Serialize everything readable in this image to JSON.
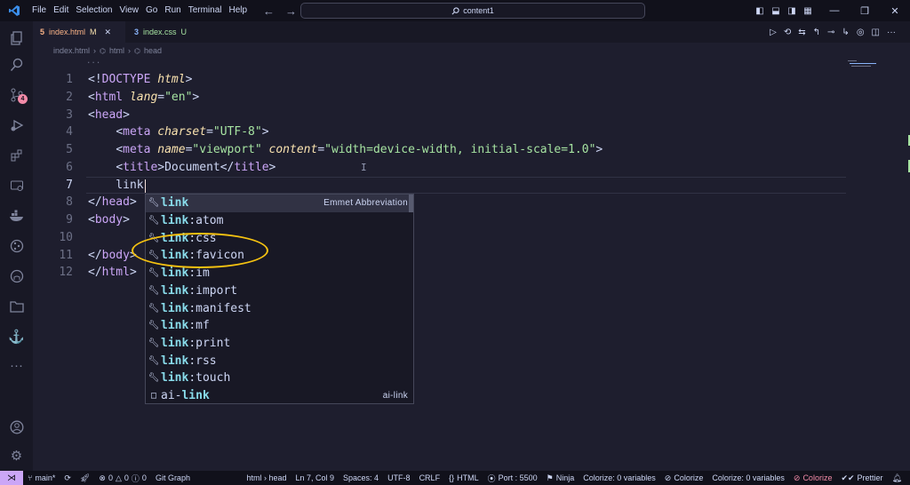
{
  "titlebar": {
    "menu": [
      "File",
      "Edit",
      "Selection",
      "View",
      "Go",
      "Run",
      "Terminal",
      "Help"
    ],
    "search_text": "content1"
  },
  "activity": {
    "source_control_badge": "4"
  },
  "tabs": [
    {
      "name": "index.html",
      "status": "M",
      "icon": "html-file-icon"
    },
    {
      "name": "index.css",
      "status": "U",
      "icon": "css-file-icon"
    }
  ],
  "breadcrumb": [
    "index.html",
    "html",
    "head"
  ],
  "editor": {
    "fold_dots": "...",
    "line_numbers": [
      "1",
      "2",
      "3",
      "4",
      "5",
      "6",
      "7",
      "8",
      "9",
      "10",
      "11",
      "12"
    ],
    "current_line": "7"
  },
  "suggest": {
    "items": [
      {
        "match": "link",
        "rest": "",
        "detail": "Emmet Abbreviation",
        "icon": "wrench-icon"
      },
      {
        "match": "link",
        "rest": ":atom",
        "icon": "wrench-icon"
      },
      {
        "match": "link",
        "rest": ":css",
        "icon": "wrench-icon"
      },
      {
        "match": "link",
        "rest": ":favicon",
        "icon": "wrench-icon"
      },
      {
        "match": "link",
        "rest": ":im",
        "icon": "wrench-icon"
      },
      {
        "match": "link",
        "rest": ":import",
        "icon": "wrench-icon"
      },
      {
        "match": "link",
        "rest": ":manifest",
        "icon": "wrench-icon"
      },
      {
        "match": "link",
        "rest": ":mf",
        "icon": "wrench-icon"
      },
      {
        "match": "link",
        "rest": ":print",
        "icon": "wrench-icon"
      },
      {
        "match": "link",
        "rest": ":rss",
        "icon": "wrench-icon"
      },
      {
        "match": "link",
        "rest": ":touch",
        "icon": "wrench-icon"
      },
      {
        "prefix": "ai-",
        "match": "link",
        "rest": "",
        "detail": "ai-link",
        "icon": "snippet-icon"
      }
    ]
  },
  "statusbar": {
    "branch": "main*",
    "errors": "0",
    "warnings": "0",
    "info": "0",
    "git_graph": "Git Graph",
    "breadcrumb": "html › head",
    "position": "Ln 7, Col 9",
    "spaces": "Spaces: 4",
    "encoding": "UTF-8",
    "eol": "CRLF",
    "language": "HTML",
    "port": "Port : 5500",
    "ninja": "Ninja",
    "colorize_vars": "Colorize: 0 variables",
    "colorize": "Colorize",
    "colorize_vars2": "Colorize: 0 variables",
    "colorize_off": "Colorize",
    "prettier": "Prettier"
  }
}
